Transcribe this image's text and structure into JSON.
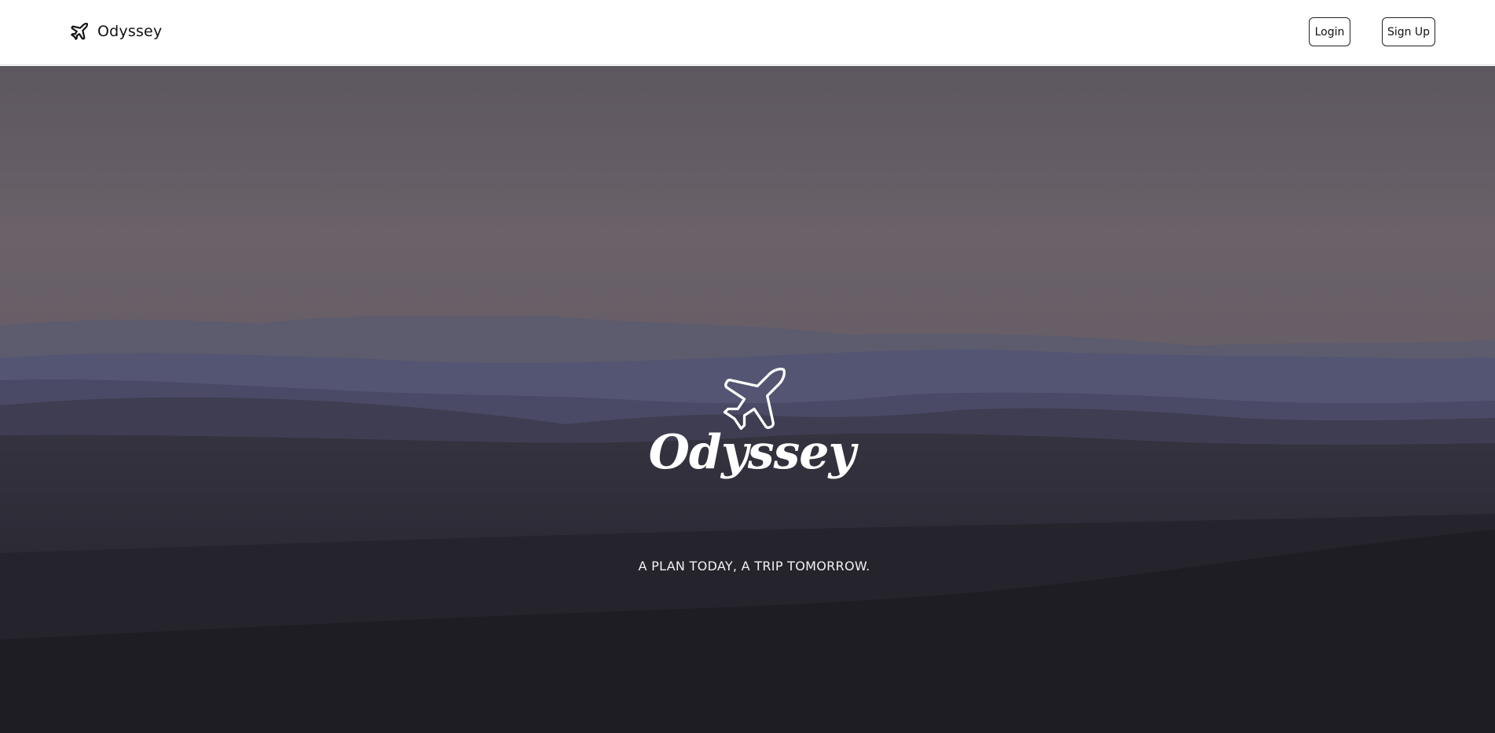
{
  "header": {
    "brand_name": "Odyssey",
    "brand_icon": "airplane-icon",
    "login_label": "Login",
    "signup_label": "Sign Up"
  },
  "hero": {
    "logo_icon": "airplane-outline-icon",
    "title": "Odyssey",
    "tagline": "A PLAN TODAY, A TRIP TOMORROW.",
    "background": "misty mountain ridges at dusk"
  },
  "colors": {
    "navbar_bg": "#ffffff",
    "sky_top": "#6b6168",
    "ridge_blue": "#4f5272",
    "foreground_dark": "#1c1b22",
    "hero_text": "#ffffff"
  }
}
